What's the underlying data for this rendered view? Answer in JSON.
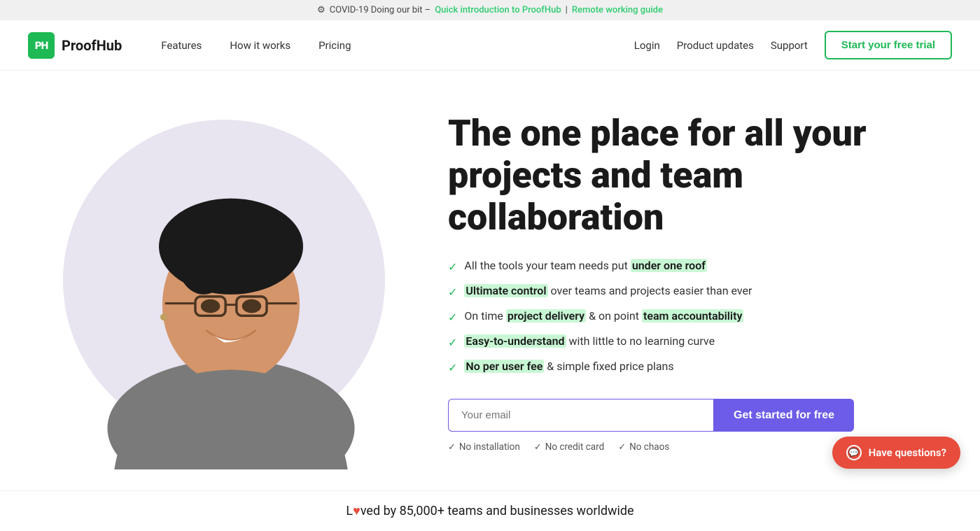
{
  "announcement": {
    "gear": "⚙",
    "prefix": "COVID-19 Doing our bit –",
    "link1_text": "Quick introduction to ProofHub",
    "separator": "|",
    "link2_text": "Remote working guide"
  },
  "nav": {
    "logo_letters": "PH",
    "logo_name": "ProofHub",
    "links": [
      {
        "label": "Features",
        "name": "nav-features"
      },
      {
        "label": "How it works",
        "name": "nav-how-it-works"
      },
      {
        "label": "Pricing",
        "name": "nav-pricing"
      }
    ],
    "right_links": [
      {
        "label": "Login",
        "name": "nav-login"
      },
      {
        "label": "Product updates",
        "name": "nav-product-updates"
      },
      {
        "label": "Support",
        "name": "nav-support"
      }
    ],
    "cta_label": "Start your free trial"
  },
  "hero": {
    "title": "The one place for all your projects and team collaboration",
    "features": [
      {
        "text_before": "All the tools your team needs put ",
        "highlight": "under one roof",
        "text_after": ""
      },
      {
        "text_before": "",
        "highlight": "Ultimate control",
        "text_after": " over teams and projects easier than ever"
      },
      {
        "text_before": "On time ",
        "highlight": "project delivery",
        "text_middle": " & on point ",
        "highlight2": "team accountability",
        "text_after": ""
      },
      {
        "text_before": "",
        "highlight": "Easy-to-understand",
        "text_after": " with little to no learning curve"
      },
      {
        "text_before": "",
        "highlight": "No per user fee",
        "text_after": " & simple fixed price plans"
      }
    ],
    "email_placeholder": "Your email",
    "cta_button": "Get started for free",
    "sub_features": [
      "No installation",
      "No credit card",
      "No chaos"
    ]
  },
  "loved_by": {
    "text_before": "L",
    "heart": "♥",
    "text_after": "ved by 85,000+ teams and businesses worldwide"
  },
  "chat_widget": {
    "label": "Have questions?"
  }
}
